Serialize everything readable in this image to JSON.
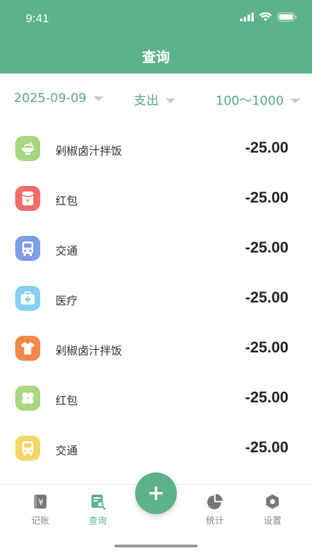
{
  "status_bar": {
    "time": "9:41"
  },
  "header": {
    "title": "查询"
  },
  "filters": {
    "date": "2025-09-09",
    "type": "支出",
    "range": "100～1000"
  },
  "colors": {
    "primary": "#5cb38b",
    "filter_text": "#5aa887",
    "light_green": "#a8d77f",
    "red": "#f36b6b",
    "blue": "#7e9ee5",
    "light_blue": "#86d0f4",
    "orange": "#f4884b",
    "yellow": "#f4d667"
  },
  "records": [
    {
      "icon": "bowl-icon",
      "color": "#a8d77f",
      "name": "剁椒卤汁拌饭",
      "amount": "-25.00"
    },
    {
      "icon": "red-envelope-icon",
      "color": "#f36b6b",
      "name": "红包",
      "amount": "-25.00"
    },
    {
      "icon": "bus-icon",
      "color": "#7e9ee5",
      "name": "交通",
      "amount": "-25.00"
    },
    {
      "icon": "medical-kit-icon",
      "color": "#86d0f4",
      "name": "医疗",
      "amount": "-25.00"
    },
    {
      "icon": "shirt-icon",
      "color": "#f4884b",
      "name": "剁椒卤汁拌饭",
      "amount": "-25.00"
    },
    {
      "icon": "clover-icon",
      "color": "#a8d77f",
      "name": "红包",
      "amount": "-25.00"
    },
    {
      "icon": "bus-icon",
      "color": "#f4d667",
      "name": "交通",
      "amount": "-25.00"
    }
  ],
  "tabbar": {
    "ledger": "记账",
    "query": "查询",
    "stats": "统计",
    "settings": "设置"
  }
}
